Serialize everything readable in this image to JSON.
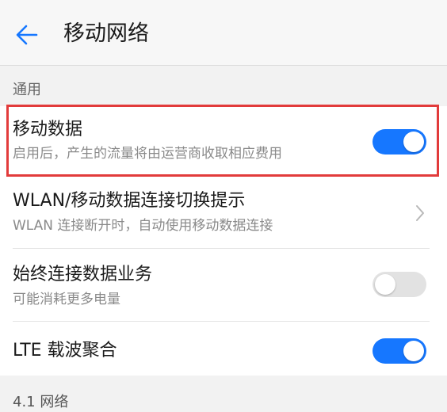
{
  "header": {
    "title": "移动网络",
    "back_icon": "back-arrow-icon"
  },
  "section": {
    "title": "通用"
  },
  "rows": [
    {
      "title": "移动数据",
      "subtitle": "启用后，产生的流量将由运营商收取相应费用",
      "control": "toggle",
      "enabled": true
    },
    {
      "title": "WLAN/移动数据连接切换提示",
      "subtitle": "WLAN 连接断开时，自动使用移动数据连接",
      "control": "chevron"
    },
    {
      "title": "始终连接数据业务",
      "subtitle": "可能消耗更多电量",
      "control": "toggle",
      "enabled": false
    },
    {
      "title": "LTE 载波聚合",
      "control": "toggle",
      "enabled": true
    }
  ],
  "next_section": {
    "title": "4.1 网络"
  },
  "colors": {
    "accent": "#1677ff",
    "highlight": "#e23b3b",
    "toggle_off": "#e2e2e2"
  }
}
